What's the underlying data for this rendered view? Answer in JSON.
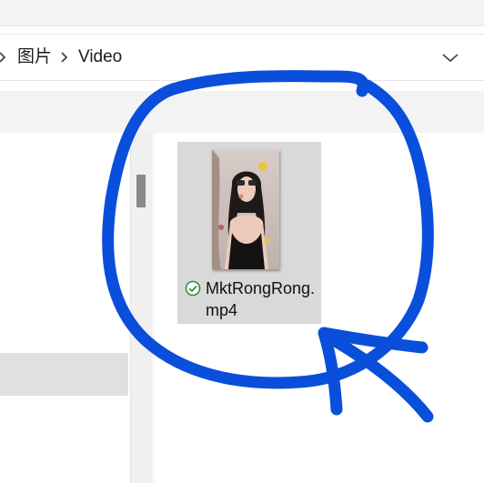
{
  "breadcrumb": {
    "items": [
      "图片",
      "Video"
    ]
  },
  "files": [
    {
      "name": "MktRongRong.mp4",
      "sync_status": "synced"
    }
  ],
  "icons": {
    "separator": "chevron-right-icon",
    "address_dropdown": "chevron-down-icon",
    "sync": "checkmark-circle-icon"
  },
  "colors": {
    "annotation": "#0a4fdb",
    "sync_ok": "#2e8b3e",
    "selected_tile": "#d9d9d9"
  }
}
